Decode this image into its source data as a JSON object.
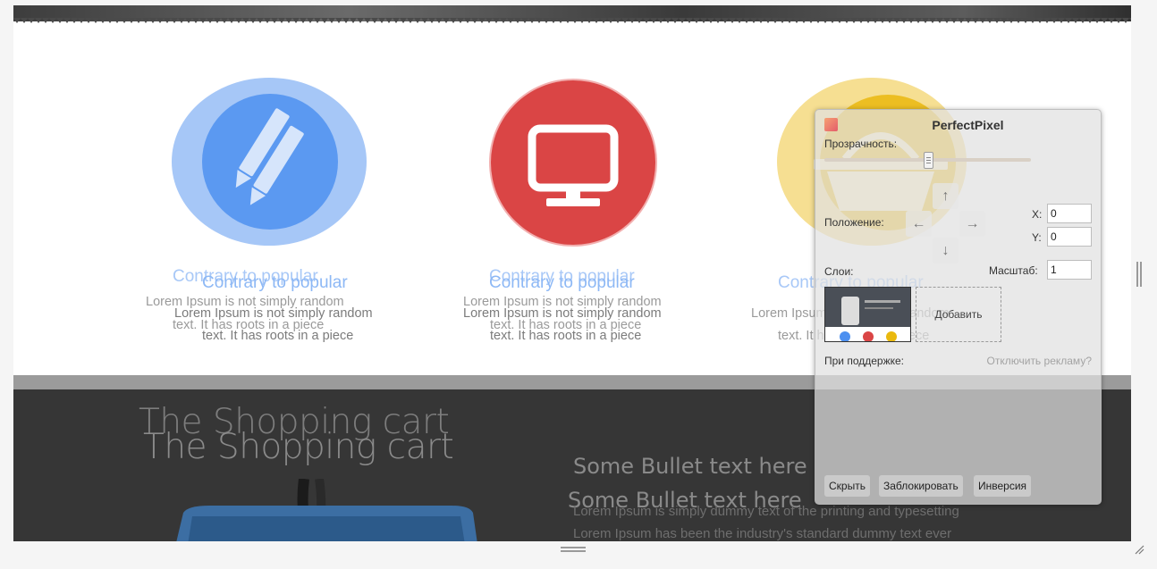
{
  "services": [
    {
      "icon": "pencil-icon",
      "color": "#4d90f0",
      "title": "Contrary to popular",
      "text_line1": "Lorem Ipsum is not simply random",
      "text_line2": "text. It has roots in a piece"
    },
    {
      "icon": "monitor-icon",
      "color": "#da4545",
      "title": "Contrary to popular",
      "text_line1": "Lorem Ipsum is not simply random",
      "text_line2": "text. It has roots in a piece"
    },
    {
      "icon": "basket-icon",
      "color": "#eab90e",
      "title": "Contrary to popular",
      "text_line1": "Lorem Ipsum is not simply random",
      "text_line2": "text. It has roots in a piece"
    }
  ],
  "cart": {
    "title": "The Shopping cart",
    "bullet": "Some Bullet text here",
    "lorem1": "Lorem Ipsum is simply dummy text of the printing and typesetting",
    "lorem2": "Lorem Ipsum has been the industry's standard dummy text ever"
  },
  "perfectpixel": {
    "title": "PerfectPixel",
    "opacity_label": "Прозрачность:",
    "opacity": 0.5,
    "position_label": "Положение:",
    "arrow_up": "↑",
    "arrow_down": "↓",
    "arrow_left": "←",
    "arrow_right": "→",
    "x_label": "X:",
    "x_value": "0",
    "y_label": "Y:",
    "y_value": "0",
    "layers_label": "Слои:",
    "scale_label": "Масштаб:",
    "scale_value": "1",
    "add_label": "Добавить",
    "support_label": "При поддержке:",
    "disable_ads": "Отключить рекламу?",
    "hide_button": "Скрыть",
    "lock_button": "Заблокировать",
    "invert_button": "Инверсия"
  }
}
